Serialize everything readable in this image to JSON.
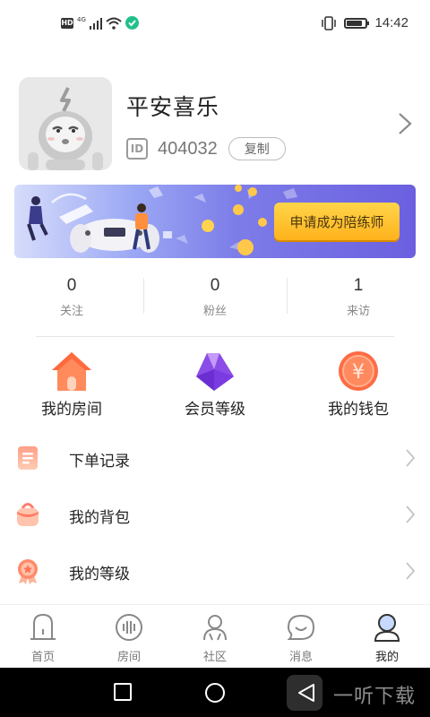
{
  "status_bar": {
    "hd": "HD",
    "network": "4G",
    "time": "14:42",
    "battery_level": 0.85
  },
  "profile": {
    "username": "平安喜乐",
    "id_label": "ID",
    "id_value": "404032",
    "copy_label": "复制"
  },
  "banner": {
    "cta_label": "申请成为陪练师",
    "coin_symbol": "¥"
  },
  "stats": [
    {
      "value": "0",
      "label": "关注"
    },
    {
      "value": "0",
      "label": "粉丝"
    },
    {
      "value": "1",
      "label": "来访"
    }
  ],
  "quick_actions": [
    {
      "label": "我的房间",
      "icon": "house-icon"
    },
    {
      "label": "会员等级",
      "icon": "gem-icon"
    },
    {
      "label": "我的钱包",
      "icon": "yuan-coin-icon"
    }
  ],
  "wallet_symbol": "¥",
  "menu": [
    {
      "label": "下单记录",
      "icon": "order-list-icon"
    },
    {
      "label": "我的背包",
      "icon": "backpack-icon"
    },
    {
      "label": "我的等级",
      "icon": "medal-icon"
    }
  ],
  "tabs": [
    {
      "label": "首页",
      "icon": "home-icon",
      "active": false
    },
    {
      "label": "房间",
      "icon": "room-icon",
      "active": false
    },
    {
      "label": "社区",
      "icon": "community-icon",
      "active": false
    },
    {
      "label": "消息",
      "icon": "message-icon",
      "active": false
    },
    {
      "label": "我的",
      "icon": "profile-icon",
      "active": true
    }
  ],
  "watermark": "一听下载",
  "colors": {
    "accent_orange": "#ff7a4a",
    "banner_purple": "#6b5fe0",
    "cta_yellow": "#ffc12e",
    "wifi_badge_green": "#22c08a"
  }
}
